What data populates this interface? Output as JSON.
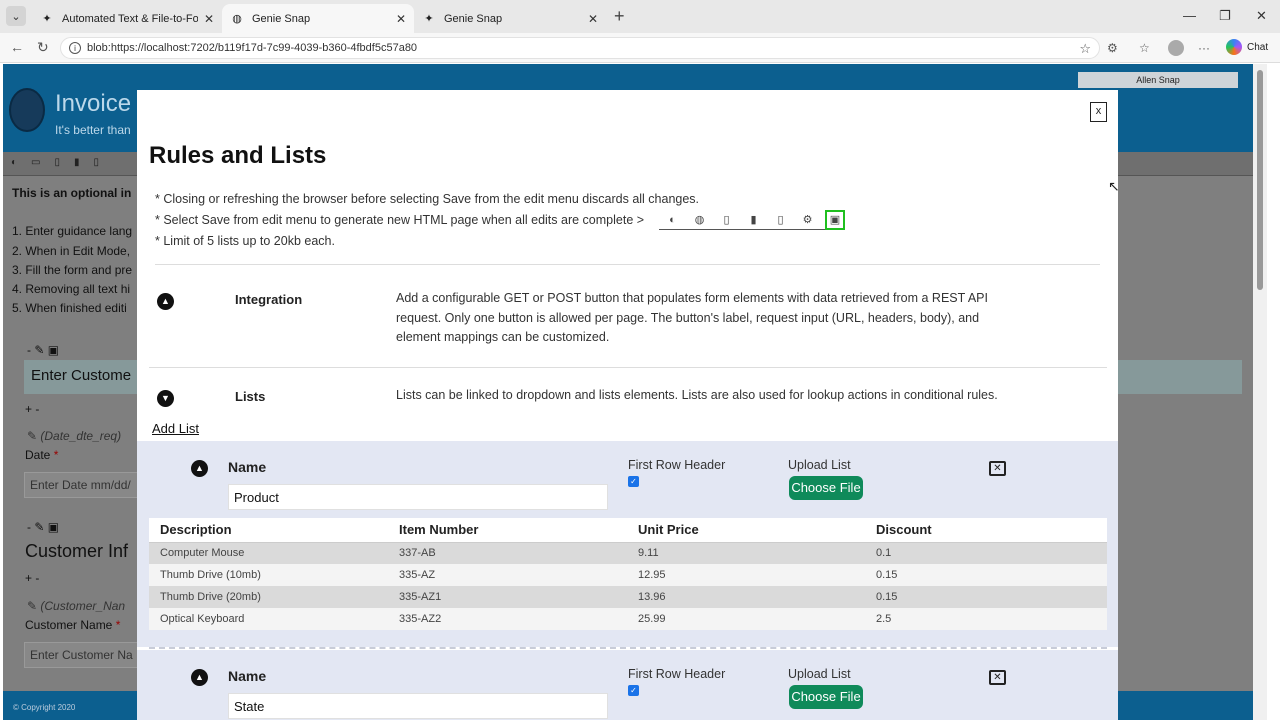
{
  "browser": {
    "tabs": [
      {
        "title": "Automated Text & File-to-Form Sc"
      },
      {
        "title": "Genie Snap"
      },
      {
        "title": "Genie Snap"
      }
    ],
    "url": "blob:https://localhost:7202/b119f17d-7c99-4039-b360-4fbdf5c57a80",
    "chat_label": "Chat"
  },
  "background": {
    "user": "Allen Snap",
    "title": "Invoice",
    "subtitle": "It's better than",
    "optional_text": "This is an optional in",
    "steps": [
      "1. Enter guidance lang",
      "2. When in Edit Mode,",
      "3. Fill the form and pre",
      "4. Removing all text hi",
      "5. When finished editi"
    ],
    "enter_customer": "Enter Custome",
    "date_tag": "(Date_dte_req)",
    "date_label": "Date",
    "date_placeholder": "Enter Date mm/dd/",
    "customer_info": "Customer Inf",
    "customer_tag": "(Customer_Nan",
    "customer_label": "Customer Name",
    "customer_placeholder": "Enter Customer Na",
    "copyright": "© Copyright 2020",
    "plus_minus": "+ -",
    "minus": "-",
    "required_mark": "*"
  },
  "modal": {
    "close_label": "x",
    "title": "Rules and Lists",
    "notes": [
      "* Closing or refreshing the browser before selecting Save from the edit menu discards all changes.",
      "* Select Save from edit menu to generate new HTML page when all edits are complete >",
      "* Limit of 5 lists up to 20kb each."
    ],
    "sections": [
      {
        "label": "Integration",
        "description": "Add a configurable GET or POST button that populates form elements with data retrieved from a REST API request. Only one button is allowed per page. The button's label, request input (URL, headers, body), and element mappings can be customized."
      },
      {
        "label": "Lists",
        "description": "Lists can be linked to dropdown and lists elements. Lists are also used for lookup actions in conditional rules."
      }
    ],
    "add_list": "Add List",
    "lists": [
      {
        "name_label": "Name",
        "name_value": "Product",
        "first_row_header": "First Row Header",
        "upload_label": "Upload List",
        "choose_file": "Choose File",
        "columns": [
          "Description",
          "Item Number",
          "Unit Price",
          "Discount"
        ],
        "rows": [
          [
            "Computer Mouse",
            "337-AB",
            "9.11",
            "0.1"
          ],
          [
            "Thumb Drive (10mb)",
            "335-AZ",
            "12.95",
            "0.15"
          ],
          [
            "Thumb Drive (20mb)",
            "335-AZ1",
            "13.96",
            "0.15"
          ],
          [
            "Optical Keyboard",
            "335-AZ2",
            "25.99",
            "2.5"
          ]
        ]
      },
      {
        "name_label": "Name",
        "name_value": "State",
        "first_row_header": "First Row Header",
        "upload_label": "Upload List",
        "choose_file": "Choose File"
      }
    ]
  },
  "colors": {
    "accent_green": "#0f8a5a",
    "header_blue": "#0c5f8f",
    "list_bg": "#e3e7f3",
    "save_highlight": "#1fbf1f"
  }
}
